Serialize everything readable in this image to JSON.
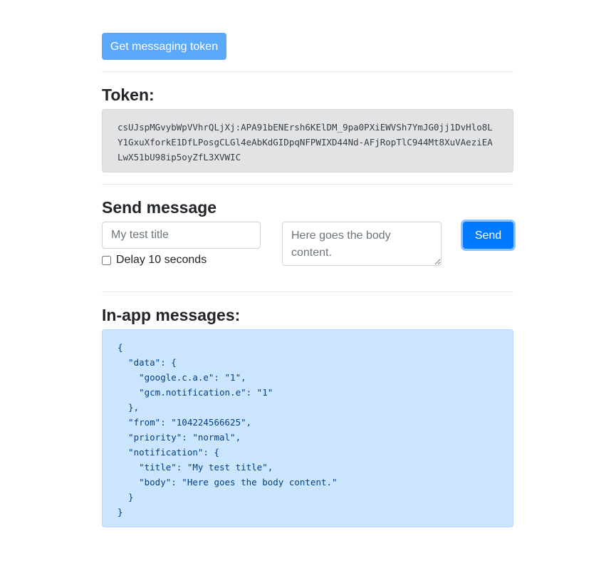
{
  "toolbar": {
    "get_token_label": "Get messaging token"
  },
  "token_section": {
    "heading": "Token:",
    "value": "csUJspMGvybWpVVhrQLjXj:APA91bENErsh6KElDM_9pa0PXiEWVSh7YmJG0jj1DvHlo8LY1GxuXforkE1DfLPosgCLGl4eAbKdGIDpqNFPWIXD44Nd-AFjRopTlC944Mt8XuVAeziEALwX51bU98ip5oyZfL3XVWIC"
  },
  "send_section": {
    "heading": "Send message",
    "title_placeholder": "My test title",
    "body_placeholder": "Here goes the body content.",
    "delay_label": "Delay 10 seconds",
    "delay_checked": false,
    "send_label": "Send"
  },
  "inapp_section": {
    "heading": "In-app messages:",
    "message_json": "{\n  \"data\": {\n    \"google.c.a.e\": \"1\",\n    \"gcm.notification.e\": \"1\"\n  },\n  \"from\": \"104224566625\",\n  \"priority\": \"normal\",\n  \"notification\": {\n    \"title\": \"My test title\",\n    \"body\": \"Here goes the body content.\"\n  }\n}"
  },
  "colors": {
    "primary": "#007bff",
    "primary_disabled": "#5aa9fb",
    "token_bg": "#e2e3e5",
    "inapp_bg": "#cce5ff",
    "inapp_text": "#004085"
  }
}
